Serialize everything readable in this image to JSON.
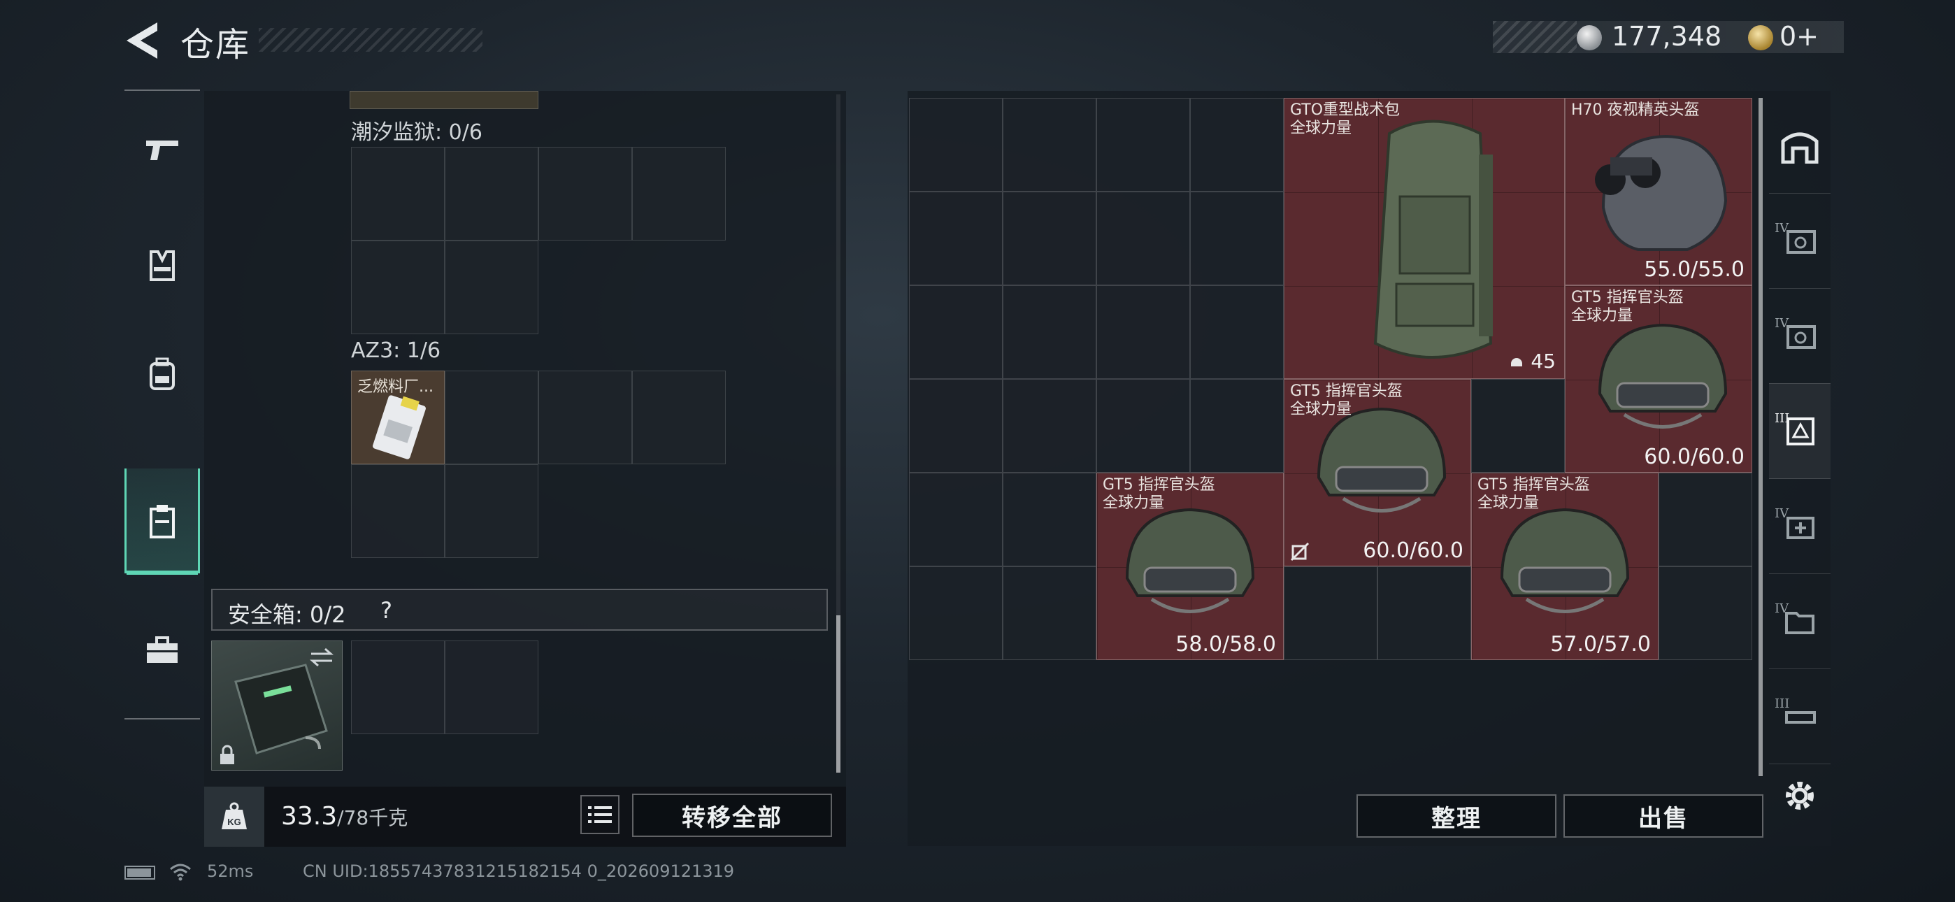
{
  "header": {
    "title": "仓库",
    "silver_amount": "177,348",
    "gold_amount": "0+"
  },
  "left_nav": {
    "items": [
      {
        "name": "weapons",
        "icon": "pistol-icon"
      },
      {
        "name": "armor",
        "icon": "vest-icon"
      },
      {
        "name": "backpack",
        "icon": "backpack-icon"
      },
      {
        "name": "inventory",
        "icon": "clipboard-icon",
        "active": true
      },
      {
        "name": "toolbox",
        "icon": "toolbox-icon"
      }
    ]
  },
  "left_panel": {
    "section1_label": "潮汐监狱: 0/6",
    "section2_label": "AZ3: 1/6",
    "section2_item_name": "乏燃料厂...",
    "safebox_label": "安全箱: 0/2",
    "safebox_help": "?",
    "weight_value": "33.3",
    "weight_max": "/78千克",
    "transfer_all": "转移全部"
  },
  "right_panel": {
    "items": [
      {
        "name": "GTO重型战术包",
        "sub": "全球力量",
        "count": "45"
      },
      {
        "name": "H70 夜视精英头盔",
        "sub": "",
        "durability": "55.0/55.0"
      },
      {
        "name": "GT5 指挥官头盔",
        "sub": "全球力量",
        "durability": "60.0/60.0"
      },
      {
        "name": "GT5 指挥官头盔",
        "sub": "全球力量",
        "durability": "60.0/60.0"
      },
      {
        "name": "GT5 指挥官头盔",
        "sub": "全球力量",
        "durability": "58.0/58.0"
      },
      {
        "name": "GT5 指挥官头盔",
        "sub": "全球力量",
        "durability": "57.0/57.0"
      }
    ],
    "sort_button": "整理",
    "sell_button": "出售",
    "tiers": [
      "IV",
      "IV",
      "III",
      "IV",
      "IV",
      "III"
    ]
  },
  "footer": {
    "ping": "52ms",
    "uid": "CN UID:18557437831215182154 0_202609121319"
  },
  "colors": {
    "accent": "#5fd6b5",
    "item_red": "#5a2a2f",
    "panel": "#161c22"
  }
}
